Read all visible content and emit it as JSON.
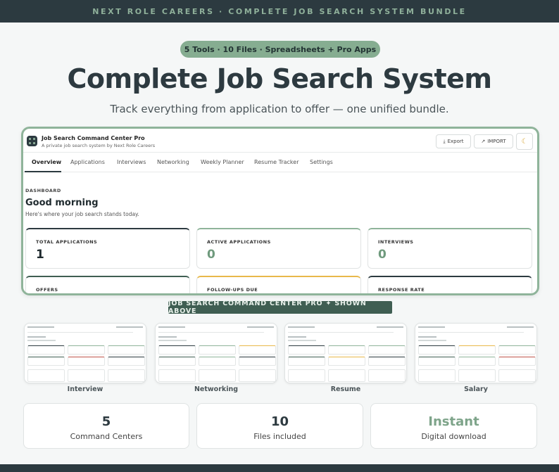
{
  "banner": {
    "text": "NEXT ROLE CAREERS  ·  COMPLETE JOB SEARCH SYSTEM BUNDLE"
  },
  "pill": {
    "text": "5 Tools  ·  10 Files  ·  Spreadsheets + Pro Apps"
  },
  "headline": "Complete Job Search System",
  "subhead": "Track everything from application to offer — one unified bundle.",
  "app": {
    "title": "Job Search Command Center Pro",
    "subtitle": "A private job search system by Next Role Careers",
    "export_label": "Export",
    "import_label": "IMPORT",
    "theme_icon": "moon-icon",
    "tabs": [
      "Overview",
      "Applications",
      "Interviews",
      "Networking",
      "Weekly Planner",
      "Resume Tracker",
      "Settings"
    ],
    "dashboard_label": "DASHBOARD",
    "greeting": "Good morning",
    "greeting_sub": "Here's where your job search stands today.",
    "cards": [
      {
        "label": "TOTAL APPLICATIONS",
        "value": "1",
        "accent": "#2c3a40"
      },
      {
        "label": "ACTIVE APPLICATIONS",
        "value": "0",
        "accent": "#8fb49a"
      },
      {
        "label": "INTERVIEWS",
        "value": "0",
        "accent": "#8fb49a"
      },
      {
        "label": "OFFERS",
        "value": "",
        "accent": "#3f5e52"
      },
      {
        "label": "FOLLOW-UPS DUE",
        "value": "",
        "accent": "#e8b84a"
      },
      {
        "label": "RESPONSE RATE",
        "value": "",
        "accent": "#2c3a40"
      }
    ]
  },
  "shown_badge": "JOB SEARCH COMMAND CENTER PRO  ✦  SHOWN ABOVE",
  "thumbnails": [
    {
      "label": "Interview"
    },
    {
      "label": "Networking"
    },
    {
      "label": "Resume"
    },
    {
      "label": "Salary"
    }
  ],
  "stats": [
    {
      "value": "5",
      "caption": "Command Centers"
    },
    {
      "value": "10",
      "caption": "Files included"
    },
    {
      "value": "Instant",
      "caption": "Digital download"
    }
  ],
  "colors": {
    "brand_dark": "#2c3a40",
    "accent_green": "#8fb49a"
  }
}
